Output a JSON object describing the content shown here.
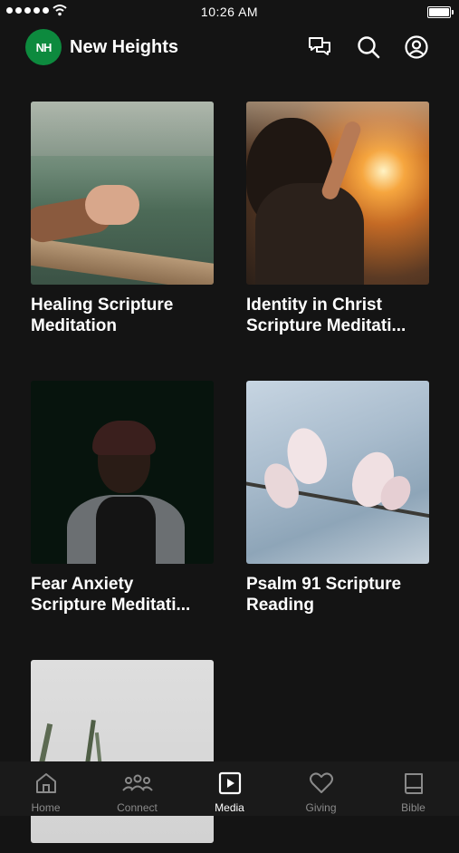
{
  "status_bar": {
    "time": "10:26 AM"
  },
  "header": {
    "logo_text": "NH",
    "app_name": "New Heights"
  },
  "media_items": [
    {
      "title": "Healing Scripture Meditation"
    },
    {
      "title": "Identity in Christ Scripture Meditati..."
    },
    {
      "title": "Fear Anxiety Scripture Meditati..."
    },
    {
      "title": "Psalm 91 Scripture Reading"
    },
    {
      "title": ""
    }
  ],
  "tabs": [
    {
      "label": "Home",
      "icon": "home-icon"
    },
    {
      "label": "Connect",
      "icon": "people-icon"
    },
    {
      "label": "Media",
      "icon": "play-square-icon",
      "active": true
    },
    {
      "label": "Giving",
      "icon": "heart-icon"
    },
    {
      "label": "Bible",
      "icon": "book-icon"
    }
  ],
  "colors": {
    "background": "#141414",
    "brand": "#0d8a3e",
    "tab_inactive": "#8a8a8a",
    "tab_active": "#ffffff"
  }
}
